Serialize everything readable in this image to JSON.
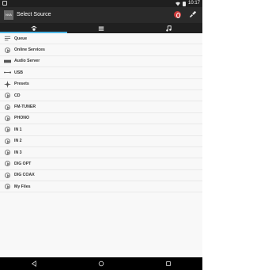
{
  "status_bar": {
    "time": "10:17"
  },
  "app_bar": {
    "title": "Select Source",
    "logo_text": "NVA",
    "power_color": "#cf3b3b"
  },
  "tabs": [
    {
      "name": "sources-tab",
      "icon": "music-note-paw-icon",
      "active": true
    },
    {
      "name": "list-tab",
      "icon": "list-icon",
      "active": false
    },
    {
      "name": "now-playing-tab",
      "icon": "music-note-icon",
      "active": false
    }
  ],
  "sources": [
    {
      "label": "Queue",
      "icon": "queue-icon"
    },
    {
      "label": "Online Services",
      "icon": "play-circle-icon"
    },
    {
      "label": "Audio Server",
      "icon": "server-icon"
    },
    {
      "label": "USB",
      "icon": "usb-icon"
    },
    {
      "label": "Presets",
      "icon": "presets-icon"
    },
    {
      "label": "CD",
      "icon": "play-circle-icon"
    },
    {
      "label": "FM-TUNER",
      "icon": "play-circle-icon"
    },
    {
      "label": "PHONO",
      "icon": "play-circle-icon"
    },
    {
      "label": "IN 1",
      "icon": "play-circle-icon"
    },
    {
      "label": "IN 2",
      "icon": "play-circle-icon"
    },
    {
      "label": "IN 3",
      "icon": "play-circle-icon"
    },
    {
      "label": "DIG OPT",
      "icon": "play-circle-icon"
    },
    {
      "label": "DIG COAX",
      "icon": "play-circle-icon"
    },
    {
      "label": "My Files",
      "icon": "play-circle-icon"
    }
  ],
  "nav": {
    "back": "back-icon",
    "home": "home-icon",
    "recents": "recents-icon"
  },
  "colors": {
    "accent": "#4eb6e6",
    "app_bar": "#2a2a2a"
  }
}
